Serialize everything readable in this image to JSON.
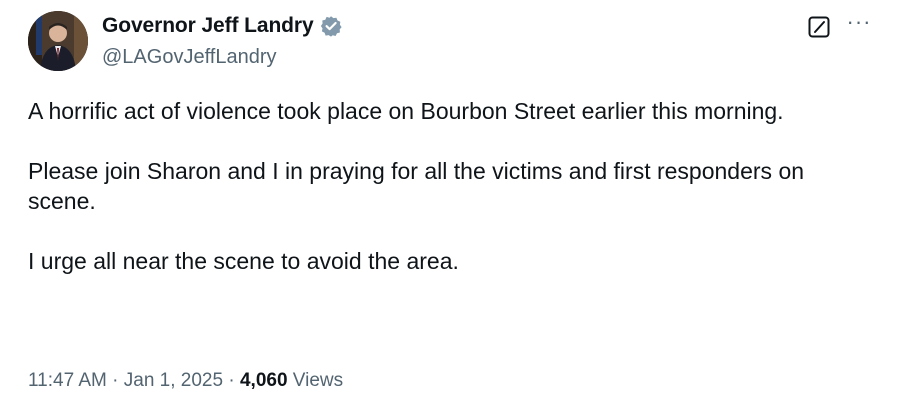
{
  "author": {
    "display_name": "Governor Jeff Landry",
    "handle": "@LAGovJeffLandry",
    "verified_icon": "verified-badge-icon",
    "verified_color": "#829aab"
  },
  "actions": {
    "grok_icon": "grok-icon",
    "more_label": "···"
  },
  "tweet": {
    "paragraphs": [
      "A horrific act of violence took place on Bourbon Street earlier this morning.",
      "Please join Sharon and I in praying for all the victims and first responders on scene.",
      "I urge all near the scene to avoid the area."
    ]
  },
  "meta": {
    "time": "11:47 AM",
    "separator": "·",
    "date": "Jan 1, 2025",
    "views_count": "4,060",
    "views_label": "Views"
  },
  "colors": {
    "text_primary": "#0f1419",
    "text_secondary": "#536471",
    "background": "#ffffff"
  }
}
